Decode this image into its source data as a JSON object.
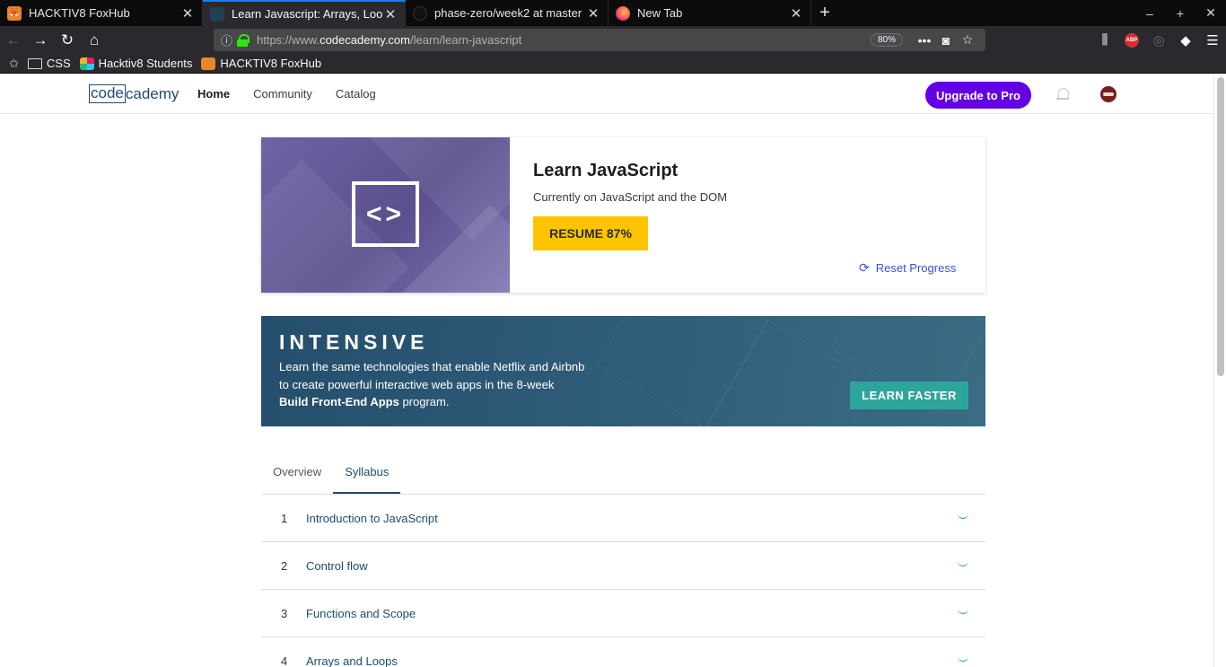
{
  "browser": {
    "tabs": [
      {
        "title": "HACKTIV8 FoxHub",
        "favicon": "fox-icon",
        "active": false
      },
      {
        "title": "Learn Javascript: Arrays, Loops",
        "favicon": "codecademy-icon",
        "active": true
      },
      {
        "title": "phase-zero/week2 at master",
        "favicon": "github-icon",
        "active": false
      },
      {
        "title": "New Tab",
        "favicon": "firefox-icon",
        "active": false
      }
    ],
    "url_prefix": "https://www.",
    "url_host": "codecademy.com",
    "url_path": "/learn/learn-javascript",
    "zoom": "80%",
    "bookmarks": [
      {
        "label": "CSS",
        "icon": "folder-icon"
      },
      {
        "label": "Hacktiv8 Students",
        "icon": "slack-icon"
      },
      {
        "label": "HACKTIV8 FoxHub",
        "icon": "fox-icon"
      }
    ],
    "abp_label": "ABP"
  },
  "site": {
    "logo_box": "code",
    "logo_rest": "cademy",
    "nav": [
      "Home",
      "Community",
      "Catalog"
    ],
    "upgrade_label": "Upgrade to Pro"
  },
  "course": {
    "title": "Learn JavaScript",
    "subtitle": "Currently on JavaScript and the DOM",
    "resume_label": "RESUME 87%",
    "progress_percent": 87,
    "reset_label": "Reset Progress",
    "art_symbol": "<>"
  },
  "banner": {
    "title": "INTENSIVE",
    "line1": "Learn the same technologies that enable Netflix and Airbnb",
    "line2": "to create powerful interactive web apps in the 8-week",
    "bold": "Build Front-End Apps",
    "tail": " program.",
    "cta": "LEARN FASTER"
  },
  "content_tabs": [
    "Overview",
    "Syllabus"
  ],
  "syllabus": [
    {
      "num": "1",
      "label": "Introduction to JavaScript"
    },
    {
      "num": "2",
      "label": "Control flow"
    },
    {
      "num": "3",
      "label": "Functions and Scope"
    },
    {
      "num": "4",
      "label": "Arrays and Loops"
    }
  ],
  "colors": {
    "upgrade": "#6400e4",
    "resume": "#ffc400",
    "cta": "#2ea59a",
    "link": "#3a50d6",
    "tab_accent": "#0a84ff"
  }
}
